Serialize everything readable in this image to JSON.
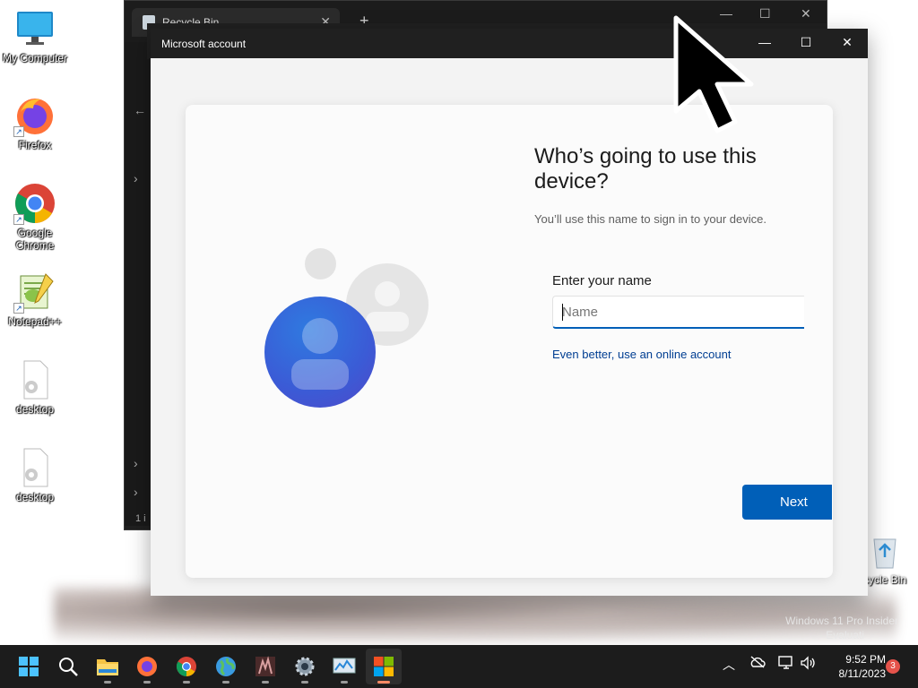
{
  "desktop": {
    "icons": [
      {
        "label": "My Computer"
      },
      {
        "label": "Firefox"
      },
      {
        "label": "Google Chrome"
      },
      {
        "label": "Notepad++"
      },
      {
        "label": "desktop"
      },
      {
        "label": "desktop"
      }
    ],
    "recycle_bin_label": "cycle Bin",
    "watermark_line1": "Windows 11 Pro Insider",
    "watermark_line2": "Evaluati"
  },
  "background_window": {
    "tab_title": "Recycle Bin",
    "tab_close": "✕",
    "new_tab": "+",
    "status_fragment": "1 i"
  },
  "dialog": {
    "title": "Microsoft account",
    "heading": "Who’s going to use this device?",
    "subtext": "You’ll use this name to sign in to your device.",
    "field_label": "Enter your name",
    "name_placeholder": "Name",
    "name_value": "",
    "online_link": "Even better, use an online account",
    "next_label": "Next"
  },
  "taskbar": {
    "time": "9:52 PM",
    "date": "8/11/2023",
    "notification_count": "3",
    "apps": [
      "start",
      "search",
      "file-explorer",
      "firefox",
      "chrome",
      "globe-app",
      "media-app",
      "settings",
      "monitor-app",
      "microsoft-store"
    ]
  },
  "colors": {
    "accent": "#005fb8",
    "link": "#003e92",
    "titlebar": "#202020"
  }
}
